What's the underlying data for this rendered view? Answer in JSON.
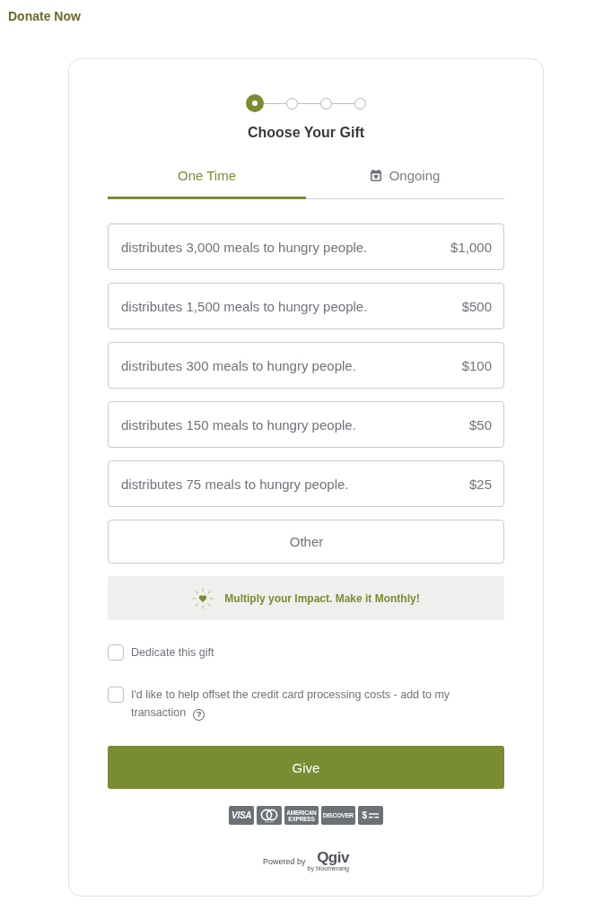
{
  "header": {
    "title": "Donate Now"
  },
  "steps": [
    {
      "current": true
    },
    {
      "current": false
    },
    {
      "current": false
    },
    {
      "current": false
    }
  ],
  "step_title": "Choose Your Gift",
  "tabs": [
    {
      "label": "One Time",
      "selected": true,
      "kind": "plain"
    },
    {
      "label": "Ongoing",
      "selected": false,
      "kind": "calendar"
    }
  ],
  "gift_options": [
    {
      "description": "distributes 3,000 meals to hungry people.",
      "amount": "$1,000",
      "selected": false
    },
    {
      "description": "distributes 1,500 meals to hungry people.",
      "amount": "$500",
      "selected": false
    },
    {
      "description": "distributes 300 meals to hungry people.",
      "amount": "$100",
      "selected": false
    },
    {
      "description": "distributes 150 meals to hungry people.",
      "amount": "$50",
      "selected": false
    },
    {
      "description": "distributes 75 meals to hungry people.",
      "amount": "$25",
      "selected": false
    }
  ],
  "other_option": {
    "label": "Other",
    "selected": false
  },
  "monthly_banner": {
    "text": "Multiply your Impact. Make it Monthly!"
  },
  "checkboxes": [
    {
      "label": "Dedicate this gift",
      "checked": false
    },
    {
      "label": "I'd like to help offset the credit card processing costs - add to my transaction",
      "checked": false,
      "help": "?"
    }
  ],
  "give_button": {
    "label": "Give"
  },
  "payment_methods": [
    {
      "kind": "visa",
      "label": "VISA"
    },
    {
      "kind": "mastercard"
    },
    {
      "kind": "amex",
      "label": "AMERICAN EXPRESS"
    },
    {
      "kind": "discover",
      "label": "DISCOVER"
    },
    {
      "kind": "check",
      "label": "$"
    }
  ],
  "powered_by": {
    "label": "Powered by",
    "logo": "Qgiv",
    "tagline": "by bloomerang"
  }
}
